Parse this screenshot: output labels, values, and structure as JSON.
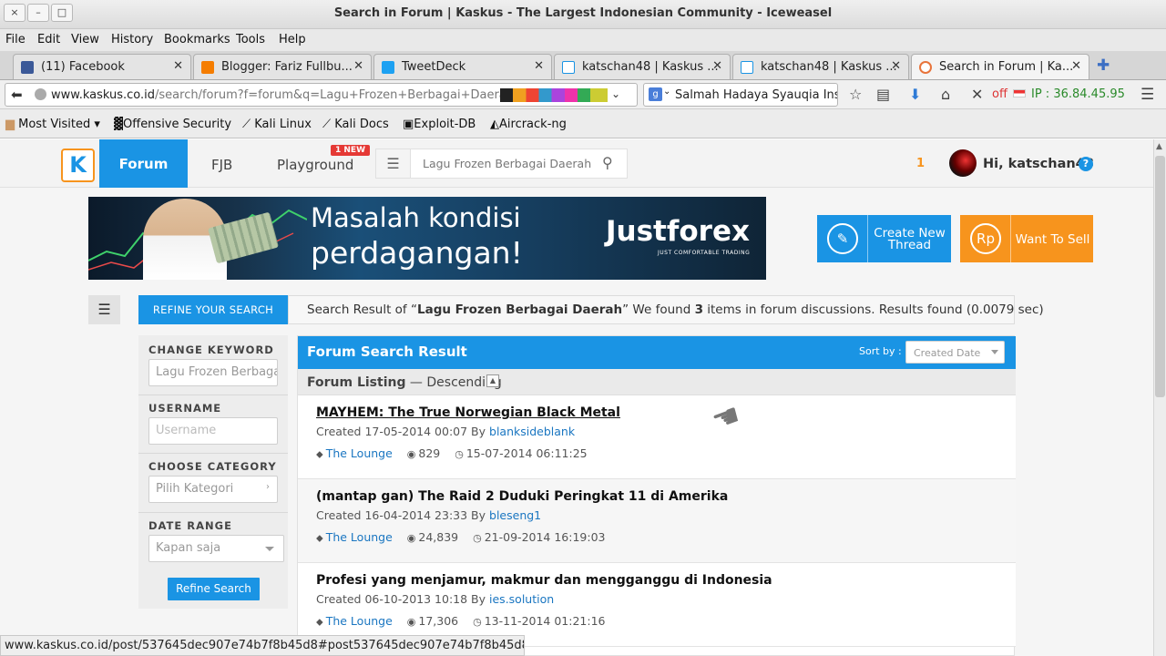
{
  "window": {
    "title": "Search in Forum | Kaskus - The Largest Indonesian Community - Iceweasel",
    "controls": [
      "×",
      "–",
      "□"
    ]
  },
  "menubar": [
    "File",
    "Edit",
    "View",
    "History",
    "Bookmarks",
    "Tools",
    "Help"
  ],
  "tabs": [
    {
      "label": "(11) Facebook",
      "favicon": "facebook-icon",
      "color": "#3b5998"
    },
    {
      "label": "Blogger: Fariz Fullbu...",
      "favicon": "blogger-icon",
      "color": "#f57d00"
    },
    {
      "label": "TweetDeck",
      "favicon": "tweetdeck-icon",
      "color": "#1da1f2"
    },
    {
      "label": "katschan48 | Kaskus ...",
      "favicon": "kaskus-icon",
      "color": "#1a94e4"
    },
    {
      "label": "katschan48 | Kaskus ...",
      "favicon": "kaskus-icon",
      "color": "#1a94e4"
    },
    {
      "label": "Search in Forum | Ka...",
      "favicon": "loading-icon",
      "color": "#e8743b"
    }
  ],
  "navbar": {
    "url_host": "www.kaskus.co.id",
    "url_path": "/search/forum?f=forum&q=Lagu+Frozen+Berbagai+Daerah",
    "search_value": "Salmah Hadaya Syauqia Ins",
    "proxy_status": "off",
    "ip_text": "IP : 36.84.45.95"
  },
  "bookmarks": [
    "Most Visited",
    "Offensive Security",
    "Kali Linux",
    "Kali Docs",
    "Exploit-DB",
    "Aircrack-ng"
  ],
  "kaskus": {
    "logo": "K",
    "nav": {
      "forum": "Forum",
      "fjb": "FJB",
      "playground": "Playground",
      "new_badge": "1 NEW"
    },
    "search_value": "Lagu Frozen Berbagai Daerah",
    "notif_count": "1",
    "greeting": "Hi, katschan48",
    "help": "?"
  },
  "banner": {
    "line1": "Masalah kondisi",
    "line2": "perdagangan!",
    "brand": "Justforex",
    "tagline": "JUST COMFORTABLE TRADING"
  },
  "cta": {
    "create_thread": "Create New Thread",
    "want_to_sell": "Want To Sell"
  },
  "refine": {
    "tab_label": "REFINE YOUR SEARCH",
    "result_prefix": "Search Result of “",
    "result_query": "Lagu Frozen Berbagai Daerah",
    "result_mid": "” We found ",
    "result_count": "3",
    "result_suffix": " items in forum discussions. Results found (0.0079 sec)",
    "change_keyword_label": "CHANGE KEYWORD",
    "keyword_value": "Lagu Frozen Berbagai Daerah",
    "username_label": "USERNAME",
    "username_placeholder": "Username",
    "category_label": "CHOOSE CATEGORY",
    "category_value": "Pilih Kategori",
    "date_label": "DATE RANGE",
    "date_value": "Kapan saja",
    "button": "Refine Search"
  },
  "results": {
    "header": "Forum Search Result",
    "sort_label": "Sort by :",
    "sort_value": "Created Date",
    "listing_label": "Forum Listing",
    "listing_order": " — Descending",
    "items": [
      {
        "title": "MAYHEM: The True Norwegian Black Metal",
        "created": "Created 17-05-2014 00:07 By ",
        "author": "blanksideblank",
        "category": "The Lounge",
        "views": "829",
        "last": "15-07-2014 06:11:25"
      },
      {
        "title": "(mantap gan) The Raid 2 Duduki Peringkat 11 di Amerika",
        "created": "Created 16-04-2014 23:33 By ",
        "author": "bleseng1",
        "category": "The Lounge",
        "views": "24,839",
        "last": "21-09-2014 16:19:03"
      },
      {
        "title": "Profesi yang menjamur, makmur dan mengganggu di Indonesia",
        "created": "Created 06-10-2013 10:18 By ",
        "author": "ies.solution",
        "category": "The Lounge",
        "views": "17,306",
        "last": "13-11-2014 01:21:16"
      }
    ]
  },
  "statusbar": "www.kaskus.co.id/post/537645dec907e74b7f8b45d8#post537645dec907e74b7f8b45d8",
  "colors": {
    "kaskus_blue": "#1a94e4",
    "kaskus_orange": "#f7941d"
  }
}
